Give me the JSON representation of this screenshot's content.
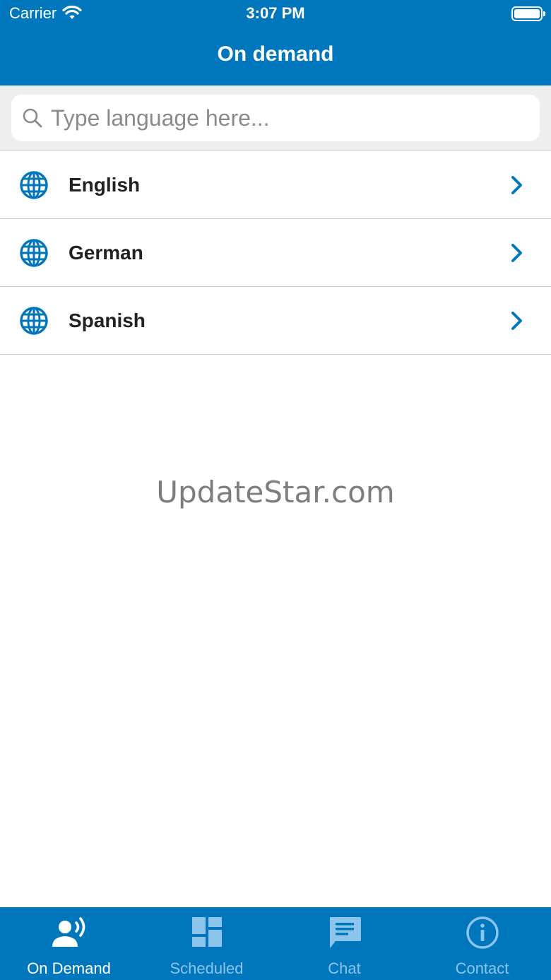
{
  "status_bar": {
    "carrier": "Carrier",
    "time": "3:07 PM"
  },
  "nav": {
    "title": "On demand"
  },
  "search": {
    "placeholder": "Type language here...",
    "value": ""
  },
  "languages": [
    {
      "label": "English",
      "icon": "globe-icon"
    },
    {
      "label": "German",
      "icon": "globe-icon"
    },
    {
      "label": "Spanish",
      "icon": "globe-icon"
    }
  ],
  "watermark": "UpdateStar.com",
  "tabs": [
    {
      "label": "On Demand",
      "icon": "voice-person-icon",
      "active": true
    },
    {
      "label": "Scheduled",
      "icon": "dashboard-icon",
      "active": false
    },
    {
      "label": "Chat",
      "icon": "chat-bubble-icon",
      "active": false
    },
    {
      "label": "Contact",
      "icon": "info-icon",
      "active": false
    }
  ],
  "colors": {
    "brand": "#0077bd",
    "inactive_tab": "#8cc4ec",
    "background": "#eeeeef"
  }
}
